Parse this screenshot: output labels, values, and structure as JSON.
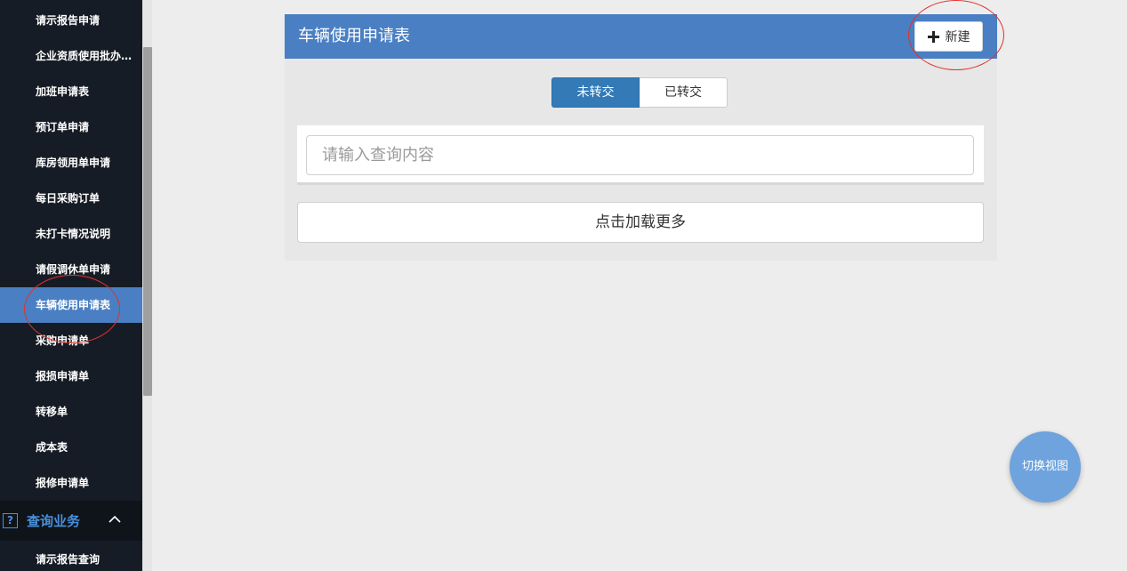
{
  "sidebar": {
    "items": [
      {
        "label": "请示报告申请",
        "active": false
      },
      {
        "label": "企业资质使用批办单申请",
        "active": false
      },
      {
        "label": "加班申请表",
        "active": false
      },
      {
        "label": "预订单申请",
        "active": false
      },
      {
        "label": "库房领用单申请",
        "active": false
      },
      {
        "label": "每日采购订单",
        "active": false
      },
      {
        "label": "未打卡情况说明",
        "active": false
      },
      {
        "label": "请假调休单申请",
        "active": false
      },
      {
        "label": "车辆使用申请表",
        "active": true
      },
      {
        "label": "采购申请单",
        "active": false
      },
      {
        "label": "报损申请单",
        "active": false
      },
      {
        "label": "转移单",
        "active": false
      },
      {
        "label": "成本表",
        "active": false
      },
      {
        "label": "报修申请单",
        "active": false
      }
    ],
    "section": {
      "label": "查询业务",
      "icon": "question-icon",
      "icon_text": "?",
      "expanded": true
    },
    "sub_item": "请示报告查询"
  },
  "panel": {
    "title": "车辆使用申请表",
    "new_button_label": "新建",
    "tabs": [
      {
        "label": "未转交",
        "selected": true
      },
      {
        "label": "已转交",
        "selected": false
      }
    ],
    "search_placeholder": "请输入查询内容",
    "load_more_label": "点击加载更多"
  },
  "fab": {
    "label": "切换视图"
  },
  "colors": {
    "sidebar_bg": "#161c25",
    "accent": "#4a7fc3",
    "tab_selected": "#337ab7",
    "annotation": "#e0322b",
    "fab": "#6ea3dd"
  }
}
